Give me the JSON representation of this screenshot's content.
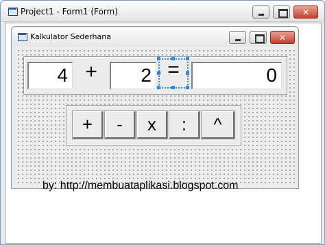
{
  "outer_window": {
    "title": "Project1 - Form1 (Form)",
    "buttons": {
      "minimize": "minimize",
      "maximize": "maximize",
      "close": "✕"
    }
  },
  "form": {
    "title": "Kalkulator Sederhana",
    "buttons": {
      "minimize": "minimize",
      "maximize": "maximize",
      "close": "✕"
    },
    "operand1": "4",
    "operator_label": "+",
    "operand2": "2",
    "equals_label": "=",
    "result": "0",
    "operation_buttons": [
      "+",
      "-",
      "x",
      ":",
      "^"
    ],
    "credit": "by: http://membuataplikasi.blogspot.com"
  },
  "colors": {
    "selection": "#1e8ff0",
    "close_button": "#c7402d"
  }
}
